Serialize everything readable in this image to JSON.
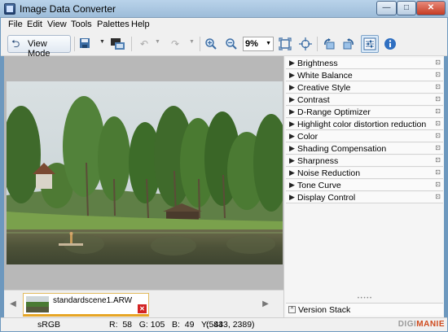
{
  "window": {
    "title": "Image Data Converter",
    "minimize": "—",
    "maximize": "□",
    "close": "✕"
  },
  "menu": [
    "File",
    "Edit",
    "View",
    "Tools",
    "Palettes",
    "Help"
  ],
  "toolbar": {
    "view_mode_label": "View Mode",
    "zoom_value": "9%"
  },
  "filmstrip": {
    "file_name": "standardscene1.ARW",
    "prev": "◀",
    "next": "▶"
  },
  "palettes": [
    "Brightness",
    "White Balance",
    "Creative Style",
    "Contrast",
    "D-Range Optimizer",
    "Highlight color distortion reduction",
    "Color",
    "Shading Compensation",
    "Sharpness",
    "Noise Reduction",
    "Tone Curve",
    "Display Control"
  ],
  "version_stack_label": "Version Stack",
  "status": {
    "color_space": "sRGB",
    "pixel_values": "R:  58   G: 105   B:  49   Y:  84",
    "coordinates": "(5433, 2389)"
  },
  "watermark": {
    "left": "DIGI",
    "right": "MANIE"
  }
}
